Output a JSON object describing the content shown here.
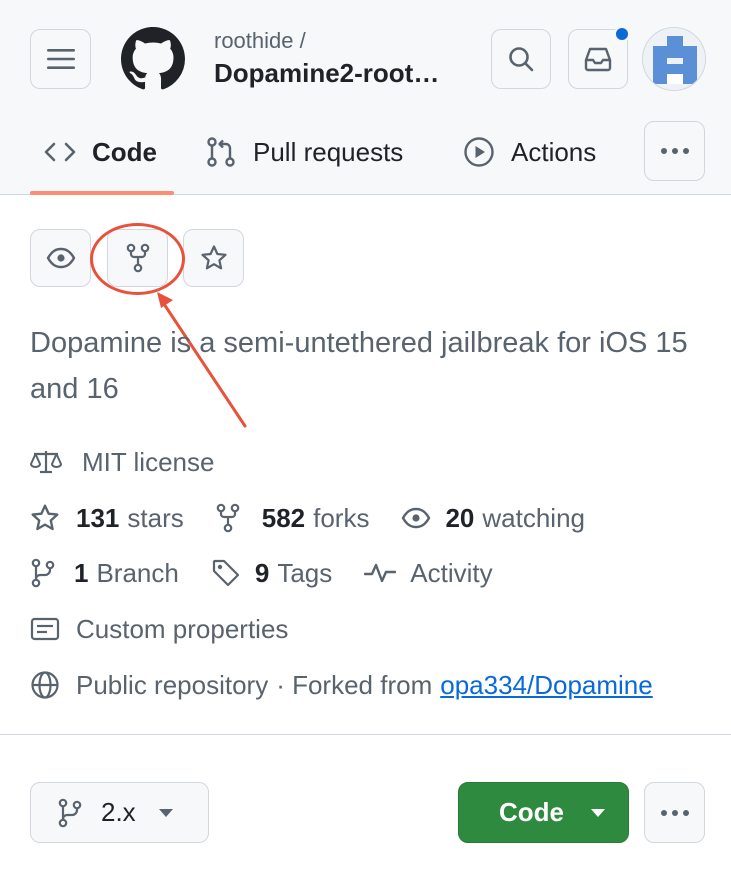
{
  "header": {
    "repo_owner": "roothide /",
    "repo_name": "Dopamine2-root…",
    "menu_icon": "hamburger-icon",
    "logo_icon": "github-mark-icon",
    "search_icon": "search-icon",
    "inbox_icon": "inbox-icon",
    "notification_color": "#0969da"
  },
  "tabs": [
    {
      "label": "Code",
      "icon": "code-icon",
      "selected": true
    },
    {
      "label": "Pull requests",
      "icon": "git-pull-request-icon",
      "selected": false
    },
    {
      "label": "Actions",
      "icon": "play-icon",
      "selected": false
    }
  ],
  "repo_actions": [
    "watch-eye-icon",
    "fork-icon",
    "star-icon"
  ],
  "description": "Dopamine is a semi-untethered jailbreak for iOS 15 and 16",
  "meta": {
    "license": "MIT license",
    "stars_count": "131",
    "stars_label": "stars",
    "forks_count": "582",
    "forks_label": "forks",
    "watching_count": "20",
    "watching_label": "watching",
    "branch_count": "1",
    "branch_label": "Branch",
    "tags_count": "9",
    "tags_label": "Tags",
    "activity_label": "Activity",
    "custom_properties": "Custom properties",
    "visibility": "Public repository",
    "forked_from_prefix": "· Forked from",
    "forked_from_link": "opa334/Dopamine"
  },
  "toolbar": {
    "branch_name": "2.x",
    "code_label": "Code"
  },
  "colors": {
    "accent_tab": "#fd8c73",
    "code_button": "#2e8a3e",
    "annotation": "#e8513a",
    "link": "#0969da"
  }
}
